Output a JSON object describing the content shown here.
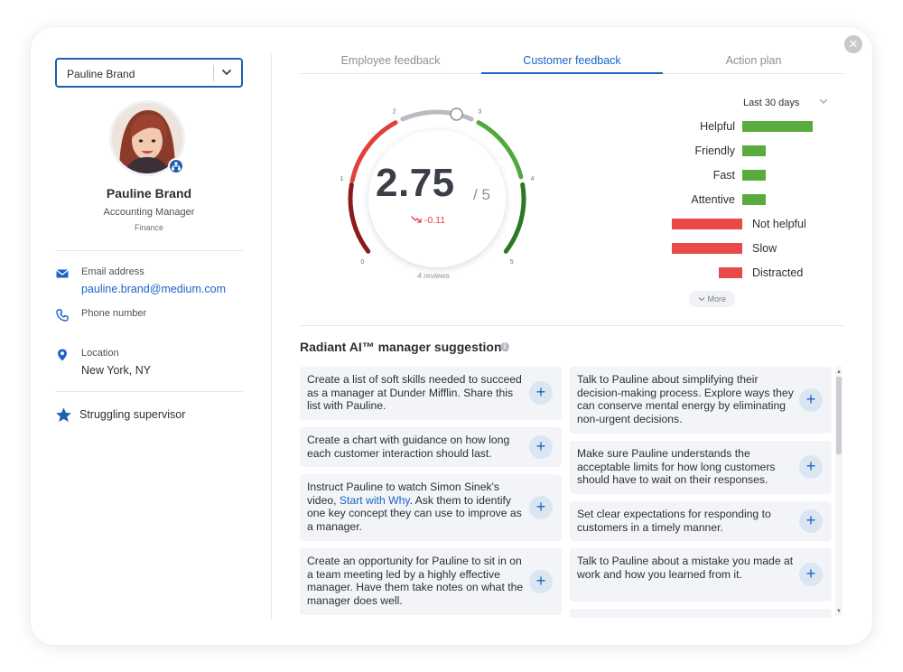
{
  "window": {
    "close_icon": "close-circle-icon"
  },
  "person_select": {
    "value": "Pauline Brand"
  },
  "profile": {
    "name": "Pauline Brand",
    "title": "Accounting Manager",
    "department": "Finance"
  },
  "contact": {
    "email_label": "Email address",
    "email_value": "pauline.brand@medium.com",
    "phone_label": "Phone number",
    "location_label": "Location",
    "location_value": "New York, NY"
  },
  "status": {
    "label": "Struggling supervisor"
  },
  "tabs": [
    {
      "label": "Employee feedback"
    },
    {
      "label": "Customer feedback"
    },
    {
      "label": "Action plan"
    }
  ],
  "active_tab": 1,
  "range": {
    "value": "Last 30 days"
  },
  "gauge": {
    "score": "2.75",
    "max": "/ 5",
    "delta": "-0.11",
    "reviews": "4 reviews",
    "ticks": [
      "0",
      "1",
      "2",
      "3",
      "4",
      "5"
    ],
    "value": 2.75,
    "colors": {
      "low": "#8b1a1a",
      "mid_low": "#e2403f",
      "neutral": "#b8bcc2",
      "mid_high": "#4fa83d",
      "high": "#2b7a22"
    }
  },
  "chart_data": {
    "type": "bar",
    "categories": [
      "Helpful",
      "Friendly",
      "Fast",
      "Attentive",
      "Not helpful",
      "Slow",
      "Distracted"
    ],
    "values": [
      3,
      1,
      1,
      1,
      -3,
      -3,
      -1
    ],
    "positive_color": "#5aab3e",
    "negative_color": "#e84a4a"
  },
  "more_label": "More",
  "ai": {
    "title": "Radiant AI™ manager suggestions",
    "suggestions_left": [
      "Create a list of soft skills needed to succeed as a manager at Dunder Mifflin. Share this list with Pauline.",
      "Create a chart with guidance on how long each customer interaction should last.",
      "Create an opportunity for Pauline to sit in on a team meeting led by a highly effective manager. Have them take notes on what the manager does well."
    ],
    "sinek": {
      "before": "Instruct Pauline to watch Simon Sinek's video, ",
      "link": "Start with Why",
      "after": ". Ask them to identify one key concept they can use to improve as a manager."
    },
    "suggestions_right": [
      "Talk to Pauline about simplifying their decision-making process. Explore ways they can conserve mental energy by eliminating non-urgent decisions.",
      "Make sure Pauline understands the acceptable limits for how long customers should have to wait on their responses.",
      "Set clear expectations for responding to customers in a timely manner.",
      "Talk to Pauline about a mistake you made at work and how you learned from it."
    ],
    "add_label": "+"
  }
}
